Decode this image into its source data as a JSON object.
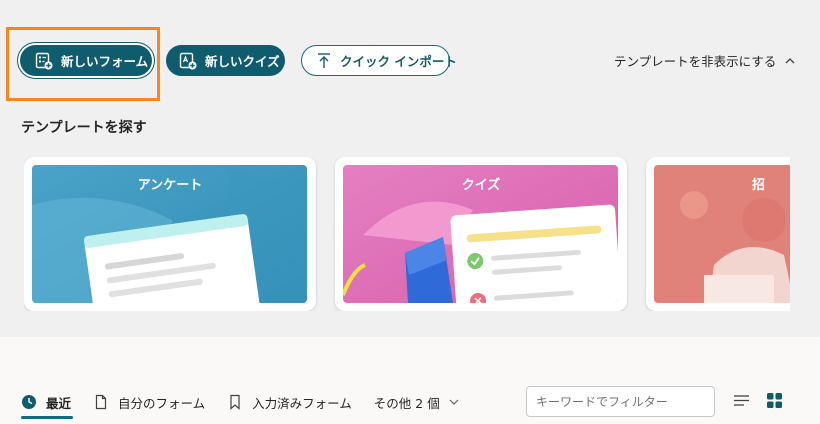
{
  "toolbar": {
    "new_form_label": "新しいフォーム",
    "new_quiz_label": "新しいクイズ",
    "quick_import_label": "クイック インポート",
    "hide_templates_label": "テンプレートを非表示にする"
  },
  "templates": {
    "section_title": "テンプレートを探す",
    "cards": [
      {
        "title": "アンケート"
      },
      {
        "title": "クイズ"
      },
      {
        "title": "招"
      }
    ]
  },
  "tabs": [
    {
      "label": "最近",
      "icon": "clock-icon",
      "active": true
    },
    {
      "label": "自分のフォーム",
      "icon": "document-icon",
      "active": false
    },
    {
      "label": "入力済みフォーム",
      "icon": "bookmark-icon",
      "active": false
    },
    {
      "label": "その他 2 個",
      "icon": "chevron-down-icon",
      "active": false
    }
  ],
  "filter": {
    "placeholder": "キーワードでフィルター"
  },
  "colors": {
    "brand": "#0f5c6e",
    "highlight": "#f7861f",
    "accent": "#0f6e7e"
  }
}
